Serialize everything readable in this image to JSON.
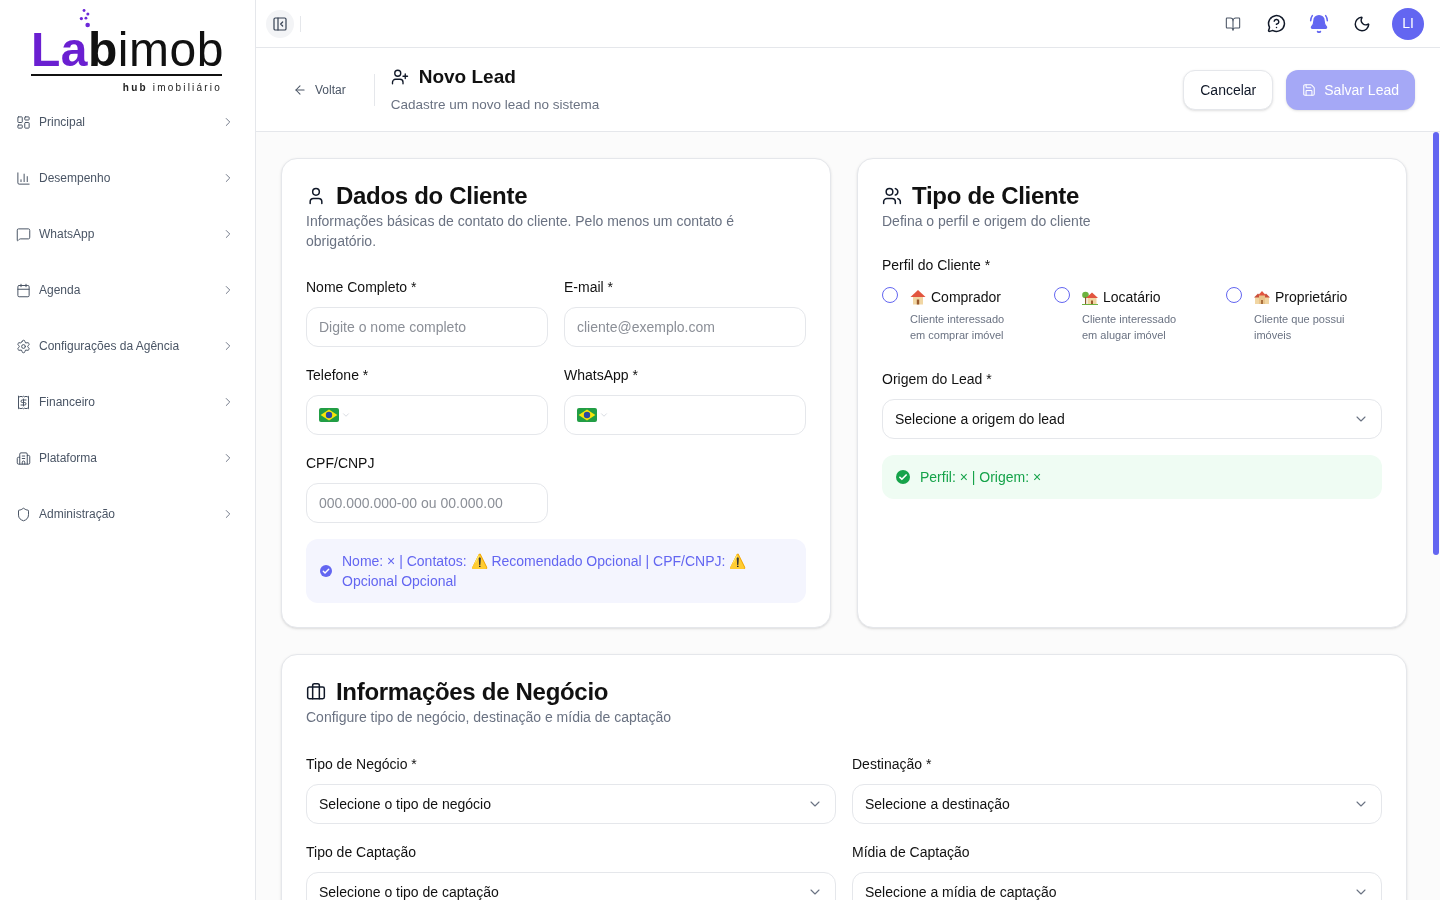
{
  "sidebar": {
    "logo": {
      "wordmark_accent": "La",
      "wordmark": "**b**imob",
      "tagline": "**hub** imobiliário"
    },
    "items": [
      {
        "label": "Principal",
        "expanded": false
      },
      {
        "label": "Desempenho",
        "expanded": false
      },
      {
        "label": "WhatsApp",
        "expanded": false
      },
      {
        "label": "Agenda",
        "expanded": false
      },
      {
        "label": "Configurações da Agência",
        "expanded": false
      },
      {
        "label": "Financeiro",
        "expanded": false
      },
      {
        "label": "Plataforma",
        "expanded": false
      },
      {
        "label": "Administração",
        "expanded": false
      }
    ]
  },
  "topbar": {
    "avatar": "LI"
  },
  "header": {
    "back": "Voltar",
    "title": "Novo Lead",
    "subtitle": "Cadastre um novo lead no sistema",
    "buttons": [
      {
        "label": "Cancelar",
        "kind": "secondary",
        "disabled": false
      },
      {
        "label": "Salvar Lead",
        "kind": "primary",
        "disabled": true
      }
    ]
  },
  "client_data": {
    "title": "Dados do Cliente",
    "description": "Informações básicas de contato do cliente. Pelo menos um contato é obrigatório.",
    "fields": [
      {
        "label": "Nome Completo *",
        "kind": "text",
        "placeholder": "Digite o nome completo"
      },
      {
        "label": "E-mail *",
        "kind": "text",
        "placeholder": "cliente@exemplo.com"
      },
      {
        "label": "Telefone *",
        "kind": "phone"
      },
      {
        "label": "WhatsApp *",
        "kind": "phone"
      },
      {
        "label": "CPF/CNPJ",
        "kind": "text",
        "placeholder": "000.000.000-00 ou 00.000.00"
      }
    ],
    "status": {
      "kind": "info",
      "text": "Nome: × | Contatos: ⚠️ Recomendado Opcional | CPF/CNPJ: ⚠️ Opcional Opcional"
    }
  },
  "client_type": {
    "title": "Tipo de Cliente",
    "description": "Defina o perfil e origem do cliente",
    "profile": {
      "label": "Perfil do Cliente *",
      "options": [
        {
          "label": "Comprador",
          "description": "Cliente interessado em comprar imóvel",
          "selected": false
        },
        {
          "label": "Locatário",
          "description": "Cliente interessado em alugar imóvel",
          "selected": false
        },
        {
          "label": "Proprietário",
          "description": "Cliente que possui imóveis",
          "selected": false
        }
      ]
    },
    "origin": {
      "label": "Origem do Lead *",
      "placeholder": "Selecione a origem do lead"
    },
    "status": {
      "kind": "success",
      "text": "Perfil: × | Origem: ×"
    }
  },
  "business": {
    "title": "Informações de Negócio",
    "description": "Configure tipo de negócio, destinação e mídia de captação",
    "fields": [
      {
        "label": "Tipo de Negócio *",
        "placeholder": "Selecione o tipo de negócio"
      },
      {
        "label": "Destinação *",
        "placeholder": "Selecione a destinação"
      },
      {
        "label": "Tipo de Captação",
        "placeholder": "Selecione o tipo de captação"
      },
      {
        "label": "Mídia de Captação",
        "placeholder": "Selecione a mídia de captação"
      }
    ]
  }
}
